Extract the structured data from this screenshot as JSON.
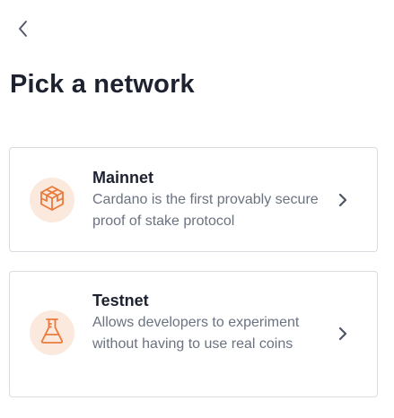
{
  "header": {
    "back_icon": "chevron-left-icon",
    "title": "Pick a network"
  },
  "networks": [
    {
      "title": "Mainnet",
      "description": "Cardano is the first provably secure proof of stake protocol",
      "icon": "cube-icon",
      "action_icon": "chevron-right-icon"
    },
    {
      "title": "Testnet",
      "description": "Allows developers to experiment without having to use real coins",
      "icon": "flask-icon",
      "action_icon": "chevron-right-icon"
    }
  ],
  "colors": {
    "accent": "#ea7a3c",
    "accent_bg": "#fbe9dd",
    "title_text": "#1e2230",
    "body_text": "#6b7280",
    "card_border": "#d9dce1"
  }
}
